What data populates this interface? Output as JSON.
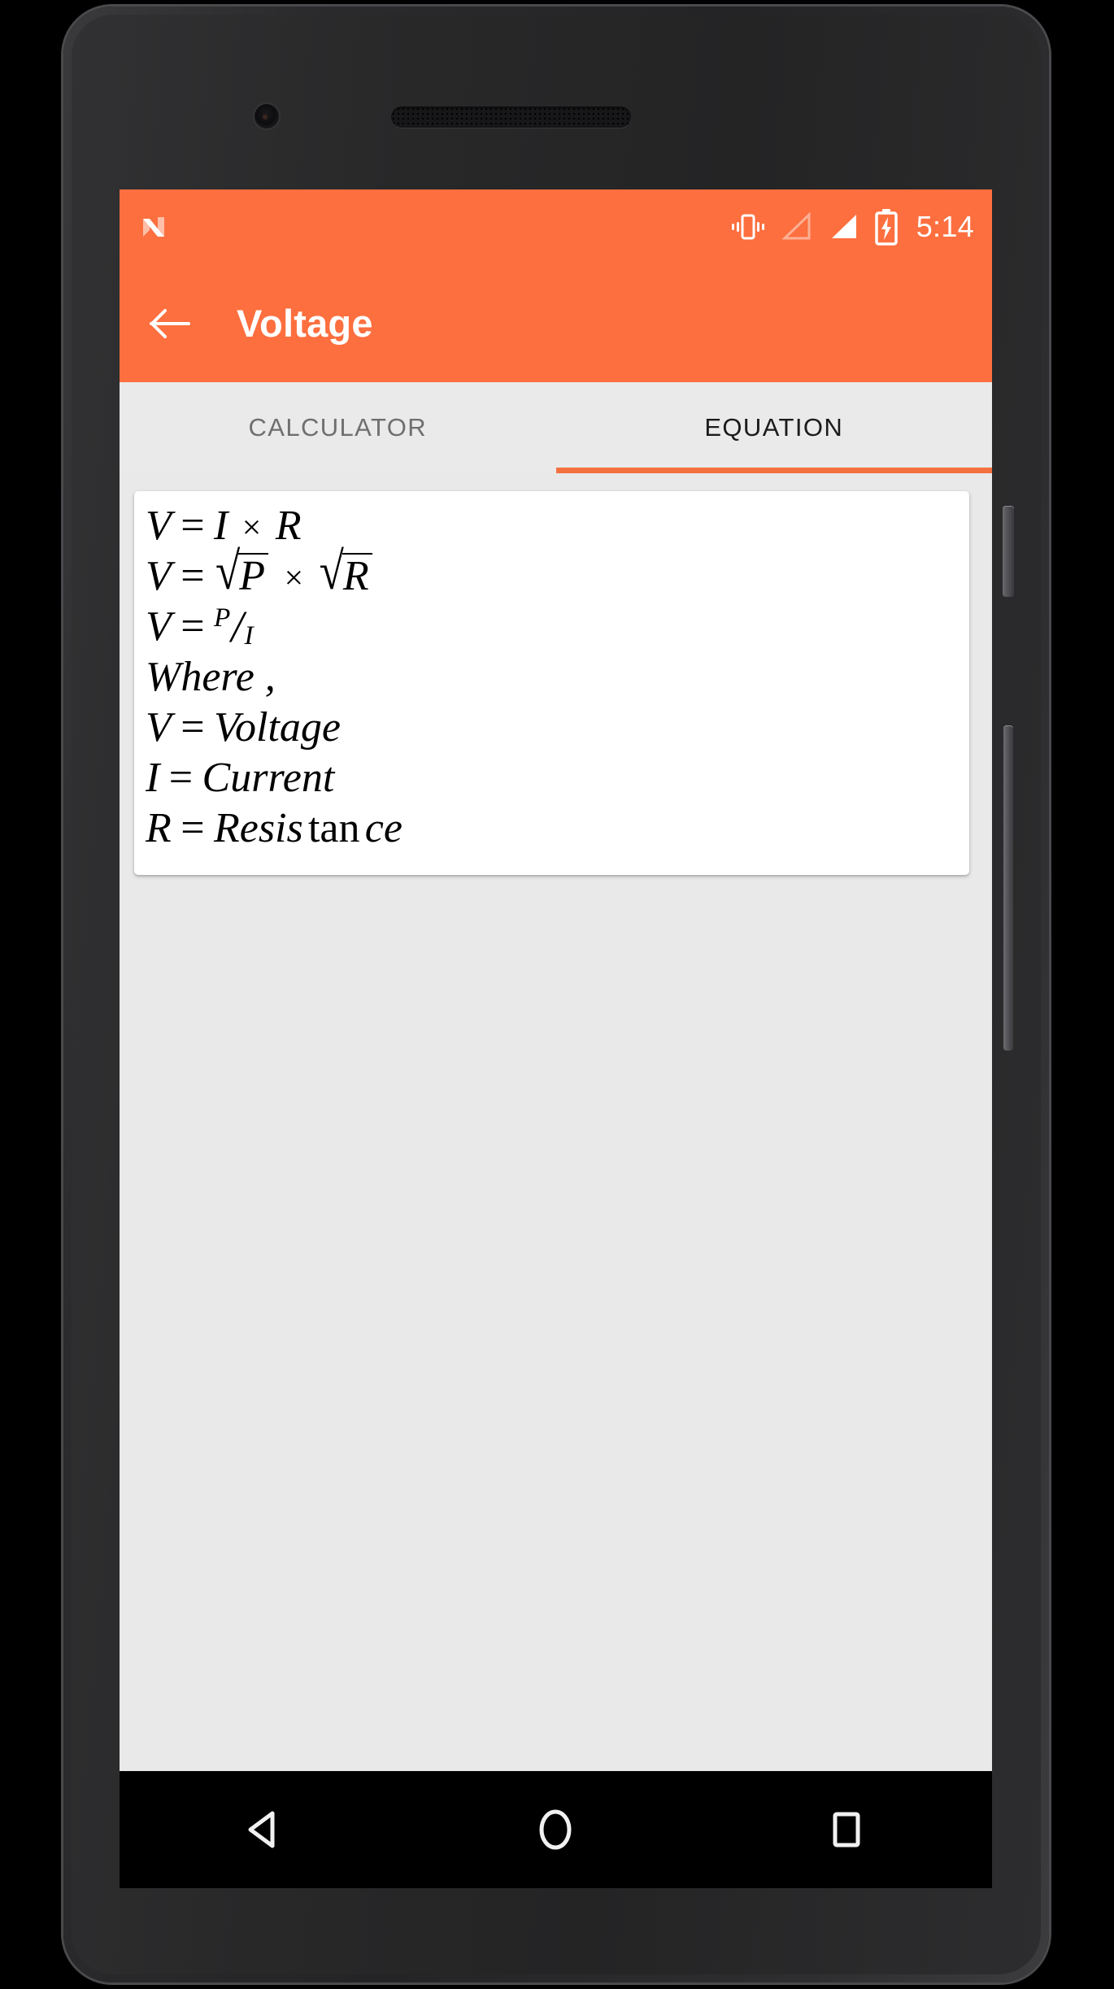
{
  "device": {
    "hardware": {
      "front_camera": "front-camera",
      "earpiece": "earpiece-speaker",
      "power_button": "power-button",
      "volume_button": "volume-rocker",
      "bottom_speaker": "bottom-speaker-grille"
    }
  },
  "status_bar": {
    "background_color": "#fd6f3f",
    "left_icon": "android-n-logo",
    "icons": [
      "vibrate-icon",
      "signal-empty-icon",
      "signal-full-icon",
      "battery-charging-icon"
    ],
    "clock": "5:14"
  },
  "toolbar": {
    "background_color": "#fd6f3f",
    "back_icon": "back-arrow-icon",
    "title": "Voltage"
  },
  "tabs": {
    "background_color": "#eaeaea",
    "indicator_color": "#f4713f",
    "items": [
      {
        "label": "CALCULATOR",
        "active": false
      },
      {
        "label": "EQUATION",
        "active": true
      }
    ]
  },
  "equation_card": {
    "background_color": "#ffffff",
    "lines": [
      {
        "id": "eq-v-ir",
        "type": "formula",
        "plain": "V = I x R",
        "lhs": "V",
        "equals": "=",
        "term1": "I",
        "operator": "×",
        "term2": "R"
      },
      {
        "id": "eq-v-sqrtp-sqrtr",
        "type": "formula-sqrt",
        "plain": "V = √P × √R",
        "lhs": "V",
        "equals": "=",
        "radical": "√",
        "radicand1": "P",
        "operator": "×",
        "radicand2": "R"
      },
      {
        "id": "eq-v-p-over-i",
        "type": "formula-fraction",
        "plain": "V = P/I",
        "lhs": "V",
        "equals": "=",
        "numerator": "P",
        "slash": "/",
        "denominator": "I"
      },
      {
        "id": "where-label",
        "type": "text",
        "plain": "Where ,",
        "text": "Where ,"
      },
      {
        "id": "def-v",
        "type": "definition",
        "plain": "V = Voltage",
        "symbol": "V",
        "equals": "=",
        "meaning": "Voltage"
      },
      {
        "id": "def-i",
        "type": "definition",
        "plain": "I = Current",
        "symbol": "I",
        "equals": "=",
        "meaning": "Current"
      },
      {
        "id": "def-r",
        "type": "definition-split",
        "plain": "R = Resis tan ce",
        "symbol": "R",
        "equals": "=",
        "meaning_part1": "Resis",
        "meaning_upright": "tan",
        "meaning_part2": "ce"
      }
    ]
  },
  "navigation_bar": {
    "background_color": "#000000",
    "buttons": [
      {
        "name": "back-nav-icon"
      },
      {
        "name": "home-nav-icon"
      },
      {
        "name": "recents-nav-icon"
      }
    ]
  }
}
